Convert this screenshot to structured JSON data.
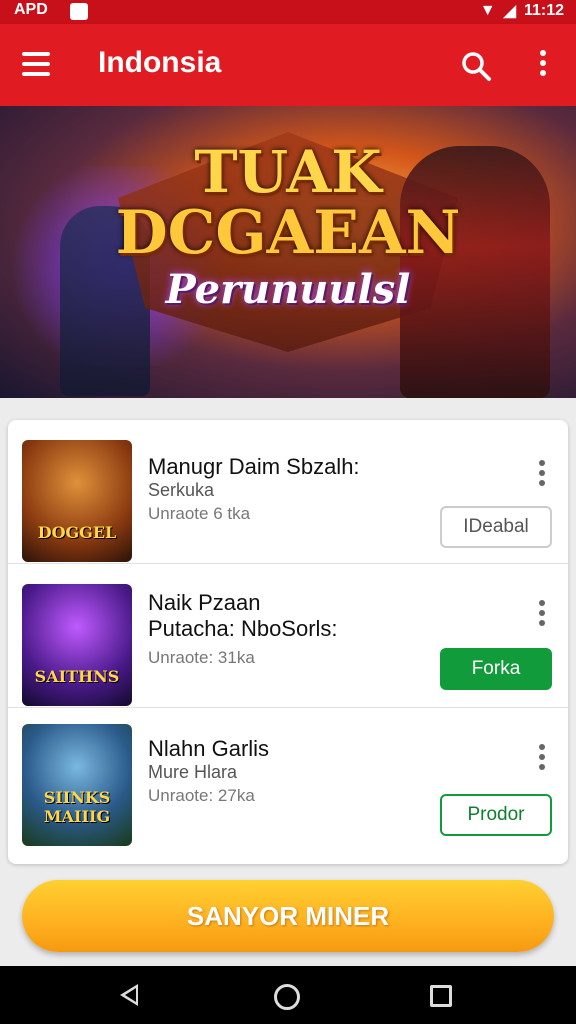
{
  "status_bar": {
    "left_text": "APD",
    "time": "11:12"
  },
  "app_bar": {
    "title": "Indonsia"
  },
  "banner": {
    "line1": "TUAK",
    "line2": "DCGAEAN",
    "line3": "Perunuulsl",
    "page_count": 2,
    "active_page": 1
  },
  "list": [
    {
      "title": "Manugr Daim Sbzalh:",
      "subtitle": "Serkuka",
      "meta": "Unraote 6 tka",
      "thumb_text": "DOGGEL",
      "button": "IDeabal",
      "button_style": "outline-gray"
    },
    {
      "title": "Naik Pzaan\nPutacha: NboSorls:",
      "subtitle": "",
      "meta": "Unraote: 31ka",
      "thumb_text": "SAITHNS",
      "button": "Forka",
      "button_style": "green"
    },
    {
      "title": "Nlahn Garlis",
      "subtitle": "Mure Hlara",
      "meta": "Unraote: 27ka",
      "thumb_text": "SIINKS MAIIIG",
      "button": "Prodor",
      "button_style": "outline-green"
    }
  ],
  "cta": {
    "label": "SANYOR MINER"
  },
  "colors": {
    "app_bar": "#e11b22",
    "green": "#119b3a",
    "cta": "#ffb020"
  }
}
